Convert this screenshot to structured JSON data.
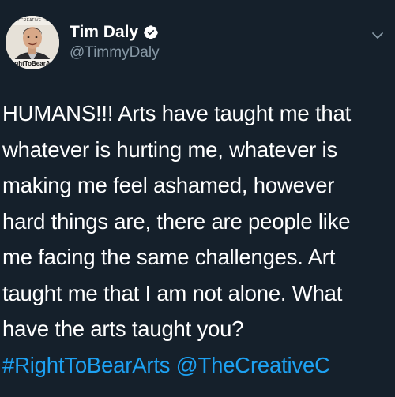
{
  "user": {
    "display_name": "Tim Daly",
    "handle": "@TimmyDaly",
    "verified": true,
    "avatar_top_text": "THE CREATIVE COAL",
    "avatar_bottom_text": "ghtToBearA"
  },
  "icons": {
    "verified": "verified-badge-icon",
    "menu": "chevron-down-icon"
  },
  "colors": {
    "background": "#15202b",
    "text": "#ffffff",
    "secondary_text": "#8899a6",
    "link": "#1da1f2"
  },
  "tweet": {
    "lines": [
      "HUMANS!!! Arts have taught me that",
      "whatever is hurting me, whatever is",
      "making me feel ashamed, however",
      "hard things are, there are people like",
      "me facing the same challenges. Art",
      "taught me that I am not alone. What",
      "have the arts taught you?"
    ],
    "hashtag": "#RightToBearArts",
    "mention": "@TheCreativeC"
  }
}
